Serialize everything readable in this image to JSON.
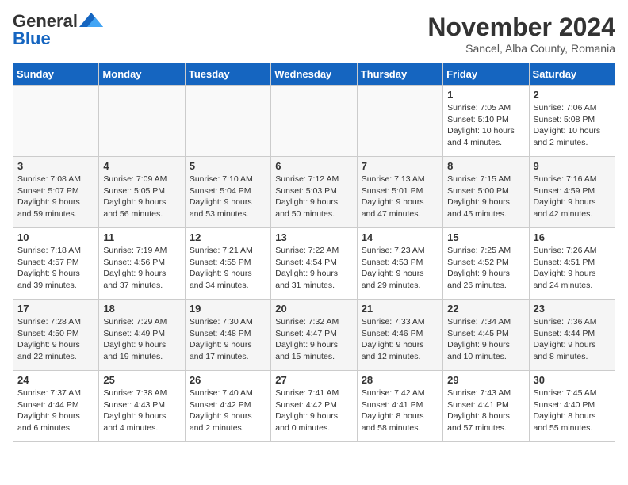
{
  "logo": {
    "text_general": "General",
    "text_blue": "Blue"
  },
  "header": {
    "month_title": "November 2024",
    "location": "Sancel, Alba County, Romania"
  },
  "weekdays": [
    "Sunday",
    "Monday",
    "Tuesday",
    "Wednesday",
    "Thursday",
    "Friday",
    "Saturday"
  ],
  "weeks": [
    [
      {
        "day": "",
        "info": ""
      },
      {
        "day": "",
        "info": ""
      },
      {
        "day": "",
        "info": ""
      },
      {
        "day": "",
        "info": ""
      },
      {
        "day": "",
        "info": ""
      },
      {
        "day": "1",
        "info": "Sunrise: 7:05 AM\nSunset: 5:10 PM\nDaylight: 10 hours\nand 4 minutes."
      },
      {
        "day": "2",
        "info": "Sunrise: 7:06 AM\nSunset: 5:08 PM\nDaylight: 10 hours\nand 2 minutes."
      }
    ],
    [
      {
        "day": "3",
        "info": "Sunrise: 7:08 AM\nSunset: 5:07 PM\nDaylight: 9 hours\nand 59 minutes."
      },
      {
        "day": "4",
        "info": "Sunrise: 7:09 AM\nSunset: 5:05 PM\nDaylight: 9 hours\nand 56 minutes."
      },
      {
        "day": "5",
        "info": "Sunrise: 7:10 AM\nSunset: 5:04 PM\nDaylight: 9 hours\nand 53 minutes."
      },
      {
        "day": "6",
        "info": "Sunrise: 7:12 AM\nSunset: 5:03 PM\nDaylight: 9 hours\nand 50 minutes."
      },
      {
        "day": "7",
        "info": "Sunrise: 7:13 AM\nSunset: 5:01 PM\nDaylight: 9 hours\nand 47 minutes."
      },
      {
        "day": "8",
        "info": "Sunrise: 7:15 AM\nSunset: 5:00 PM\nDaylight: 9 hours\nand 45 minutes."
      },
      {
        "day": "9",
        "info": "Sunrise: 7:16 AM\nSunset: 4:59 PM\nDaylight: 9 hours\nand 42 minutes."
      }
    ],
    [
      {
        "day": "10",
        "info": "Sunrise: 7:18 AM\nSunset: 4:57 PM\nDaylight: 9 hours\nand 39 minutes."
      },
      {
        "day": "11",
        "info": "Sunrise: 7:19 AM\nSunset: 4:56 PM\nDaylight: 9 hours\nand 37 minutes."
      },
      {
        "day": "12",
        "info": "Sunrise: 7:21 AM\nSunset: 4:55 PM\nDaylight: 9 hours\nand 34 minutes."
      },
      {
        "day": "13",
        "info": "Sunrise: 7:22 AM\nSunset: 4:54 PM\nDaylight: 9 hours\nand 31 minutes."
      },
      {
        "day": "14",
        "info": "Sunrise: 7:23 AM\nSunset: 4:53 PM\nDaylight: 9 hours\nand 29 minutes."
      },
      {
        "day": "15",
        "info": "Sunrise: 7:25 AM\nSunset: 4:52 PM\nDaylight: 9 hours\nand 26 minutes."
      },
      {
        "day": "16",
        "info": "Sunrise: 7:26 AM\nSunset: 4:51 PM\nDaylight: 9 hours\nand 24 minutes."
      }
    ],
    [
      {
        "day": "17",
        "info": "Sunrise: 7:28 AM\nSunset: 4:50 PM\nDaylight: 9 hours\nand 22 minutes."
      },
      {
        "day": "18",
        "info": "Sunrise: 7:29 AM\nSunset: 4:49 PM\nDaylight: 9 hours\nand 19 minutes."
      },
      {
        "day": "19",
        "info": "Sunrise: 7:30 AM\nSunset: 4:48 PM\nDaylight: 9 hours\nand 17 minutes."
      },
      {
        "day": "20",
        "info": "Sunrise: 7:32 AM\nSunset: 4:47 PM\nDaylight: 9 hours\nand 15 minutes."
      },
      {
        "day": "21",
        "info": "Sunrise: 7:33 AM\nSunset: 4:46 PM\nDaylight: 9 hours\nand 12 minutes."
      },
      {
        "day": "22",
        "info": "Sunrise: 7:34 AM\nSunset: 4:45 PM\nDaylight: 9 hours\nand 10 minutes."
      },
      {
        "day": "23",
        "info": "Sunrise: 7:36 AM\nSunset: 4:44 PM\nDaylight: 9 hours\nand 8 minutes."
      }
    ],
    [
      {
        "day": "24",
        "info": "Sunrise: 7:37 AM\nSunset: 4:44 PM\nDaylight: 9 hours\nand 6 minutes."
      },
      {
        "day": "25",
        "info": "Sunrise: 7:38 AM\nSunset: 4:43 PM\nDaylight: 9 hours\nand 4 minutes."
      },
      {
        "day": "26",
        "info": "Sunrise: 7:40 AM\nSunset: 4:42 PM\nDaylight: 9 hours\nand 2 minutes."
      },
      {
        "day": "27",
        "info": "Sunrise: 7:41 AM\nSunset: 4:42 PM\nDaylight: 9 hours\nand 0 minutes."
      },
      {
        "day": "28",
        "info": "Sunrise: 7:42 AM\nSunset: 4:41 PM\nDaylight: 8 hours\nand 58 minutes."
      },
      {
        "day": "29",
        "info": "Sunrise: 7:43 AM\nSunset: 4:41 PM\nDaylight: 8 hours\nand 57 minutes."
      },
      {
        "day": "30",
        "info": "Sunrise: 7:45 AM\nSunset: 4:40 PM\nDaylight: 8 hours\nand 55 minutes."
      }
    ]
  ]
}
